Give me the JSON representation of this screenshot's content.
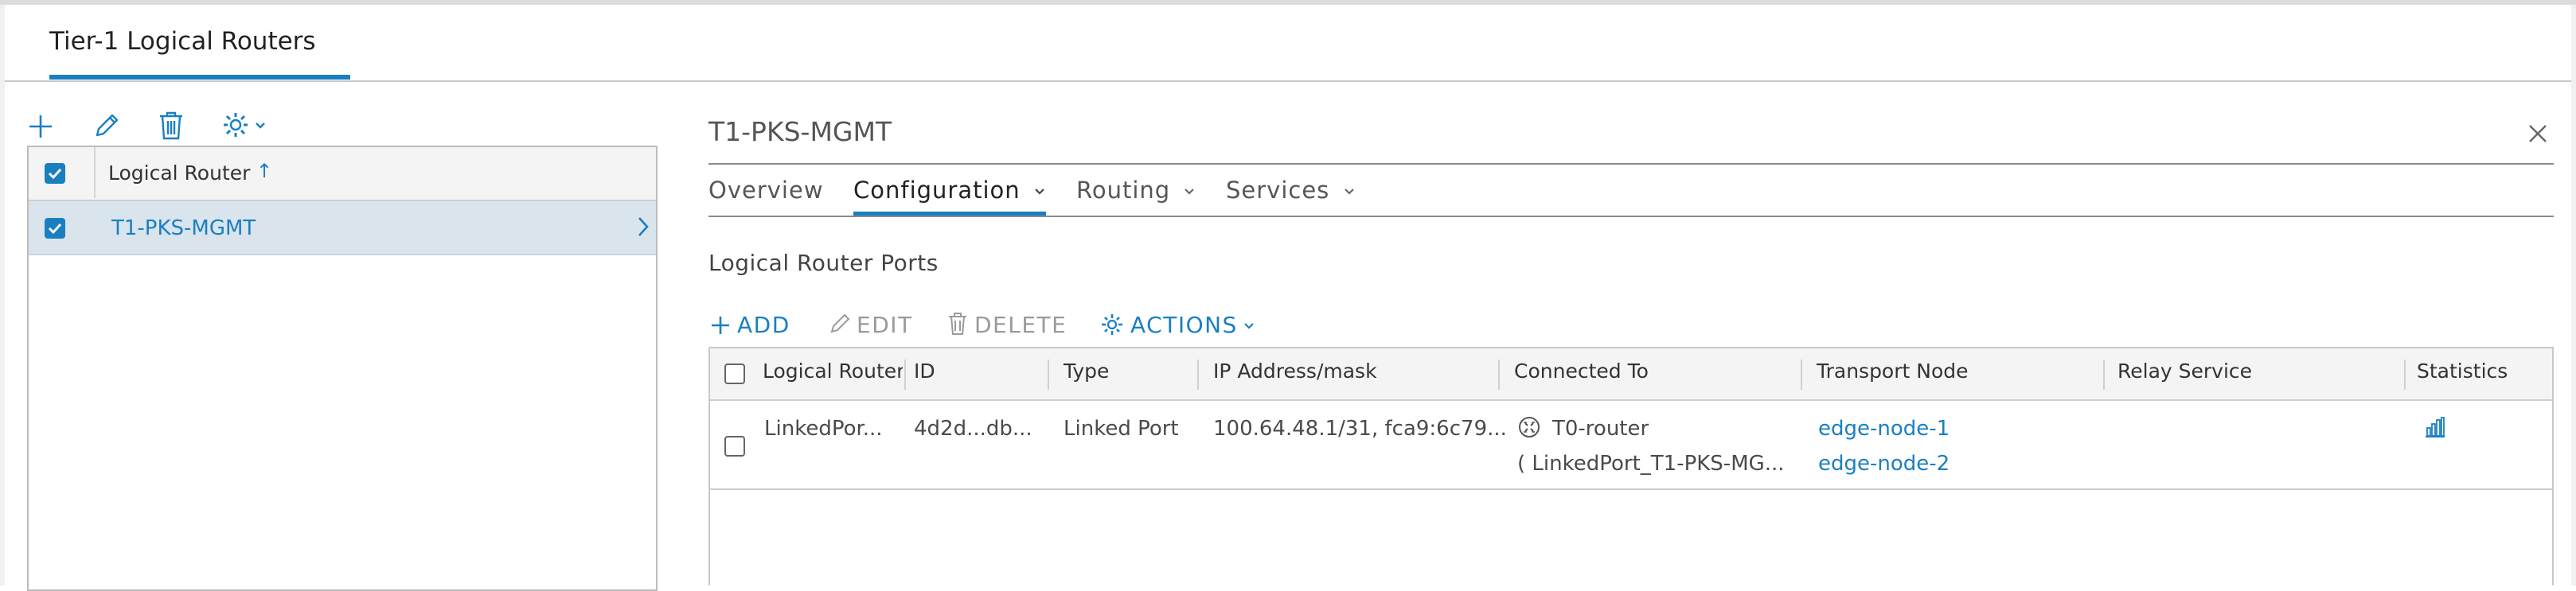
{
  "page": {
    "title": "Tier-1 Logical Routers"
  },
  "left_toolbar": {
    "add": "plus-icon",
    "edit": "pencil-icon",
    "delete": "trash-icon",
    "settings": "gear-icon"
  },
  "router_list": {
    "column_header": "Logical Router",
    "sort_indicator": "↑",
    "rows": [
      {
        "name": "T1-PKS-MGMT",
        "selected": true
      }
    ]
  },
  "detail": {
    "title": "T1-PKS-MGMT",
    "tabs": [
      {
        "label": "Overview",
        "active": false
      },
      {
        "label": "Configuration",
        "active": true
      },
      {
        "label": "Routing",
        "active": false
      },
      {
        "label": "Services",
        "active": false
      }
    ]
  },
  "ports": {
    "section_title": "Logical Router Ports",
    "actions": {
      "add": "ADD",
      "edit": "EDIT",
      "delete": "DELETE",
      "actions": "ACTIONS"
    },
    "columns": [
      "Logical Router",
      "ID",
      "Type",
      "IP Address/mask",
      "Connected To",
      "Transport Node",
      "Relay Service",
      "Statistics"
    ],
    "rows": [
      {
        "name": "LinkedPor...",
        "id": "4d2d...db...",
        "type": "Linked Port",
        "ip": "100.64.48.1/31, fca9:6c79...",
        "connected_to": "T0-router",
        "connected_port": "( LinkedPort_T1-PKS-MG...",
        "transport_nodes": [
          "edge-node-1",
          "edge-node-2"
        ],
        "relay_service": "",
        "statistics_icon": "bar-chart-icon"
      }
    ]
  },
  "colors": {
    "accent": "#1a7fc1",
    "selected_row": "#d9e4ed",
    "header_bg": "#f4f4f4"
  }
}
